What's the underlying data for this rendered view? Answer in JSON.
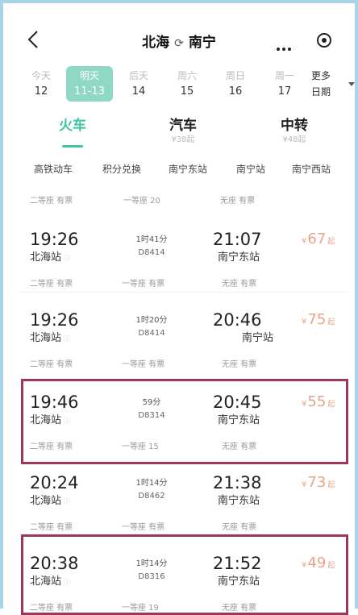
{
  "header": {
    "from": "北海",
    "swap_symbol": "⟳",
    "to": "南宁"
  },
  "dates": [
    {
      "weekday": "今天",
      "day": "12"
    },
    {
      "weekday": "明天",
      "day": "11-13"
    },
    {
      "weekday": "后天",
      "day": "14"
    },
    {
      "weekday": "周六",
      "day": "15"
    },
    {
      "weekday": "周日",
      "day": "16"
    },
    {
      "weekday": "周一",
      "day": "17"
    }
  ],
  "more_dates": {
    "line1": "更多",
    "line2": "日期"
  },
  "tabs": [
    {
      "label": "火车",
      "sub": ""
    },
    {
      "label": "汽车",
      "sub": "¥38起"
    },
    {
      "label": "中转",
      "sub": "¥48起"
    }
  ],
  "filters": [
    "高铁动车",
    "积分兑换",
    "南宁东站",
    "南宁站",
    "南宁西站"
  ],
  "top_partial": {
    "s1": "二等座 有票",
    "s2": "一等座 20",
    "s3": "无座 有票"
  },
  "trains": [
    {
      "dep_time": "19:26",
      "dep_station": "北海站",
      "duration": "1时41分",
      "train_no": "D8414",
      "arr_time": "21:07",
      "arr_station": "南宁东站",
      "price": "67",
      "s1": "二等座 有票",
      "s2": "一等座 有票",
      "s3": "无座 有票"
    },
    {
      "dep_time": "19:26",
      "dep_station": "北海站",
      "duration": "1时20分",
      "train_no": "D8414",
      "arr_time": "20:46",
      "arr_station": "南宁站",
      "price": "75",
      "s1": "二等座 有票",
      "s2": "一等座 有票",
      "s3": "无座 有票"
    },
    {
      "dep_time": "19:46",
      "dep_station": "北海站",
      "duration": "59分",
      "train_no": "D8314",
      "arr_time": "20:45",
      "arr_station": "南宁东站",
      "price": "55",
      "s1": "二等座 有票",
      "s2": "一等座 15",
      "s3": "无座 有票"
    },
    {
      "dep_time": "20:24",
      "dep_station": "北海站",
      "duration": "1时14分",
      "train_no": "D8462",
      "arr_time": "21:38",
      "arr_station": "南宁东站",
      "price": "73",
      "s1": "二等座 有票",
      "s2": "一等座 有票",
      "s3": "无座 有票"
    },
    {
      "dep_time": "20:38",
      "dep_station": "北海站",
      "duration": "1时14分",
      "train_no": "D8316",
      "arr_time": "21:52",
      "arr_station": "南宁东站",
      "price": "49",
      "s1": "二等座 有票",
      "s2": "一等座 19",
      "s3": "无座 有票"
    }
  ],
  "price_prefix": "¥",
  "price_suffix": "起",
  "colors": {
    "accent": "#41c3a6",
    "selected_date_bg": "#8fd8c6",
    "price": "#e9a38b",
    "highlight_border": "#a0355b",
    "frame_border": "#a9d4e8"
  }
}
